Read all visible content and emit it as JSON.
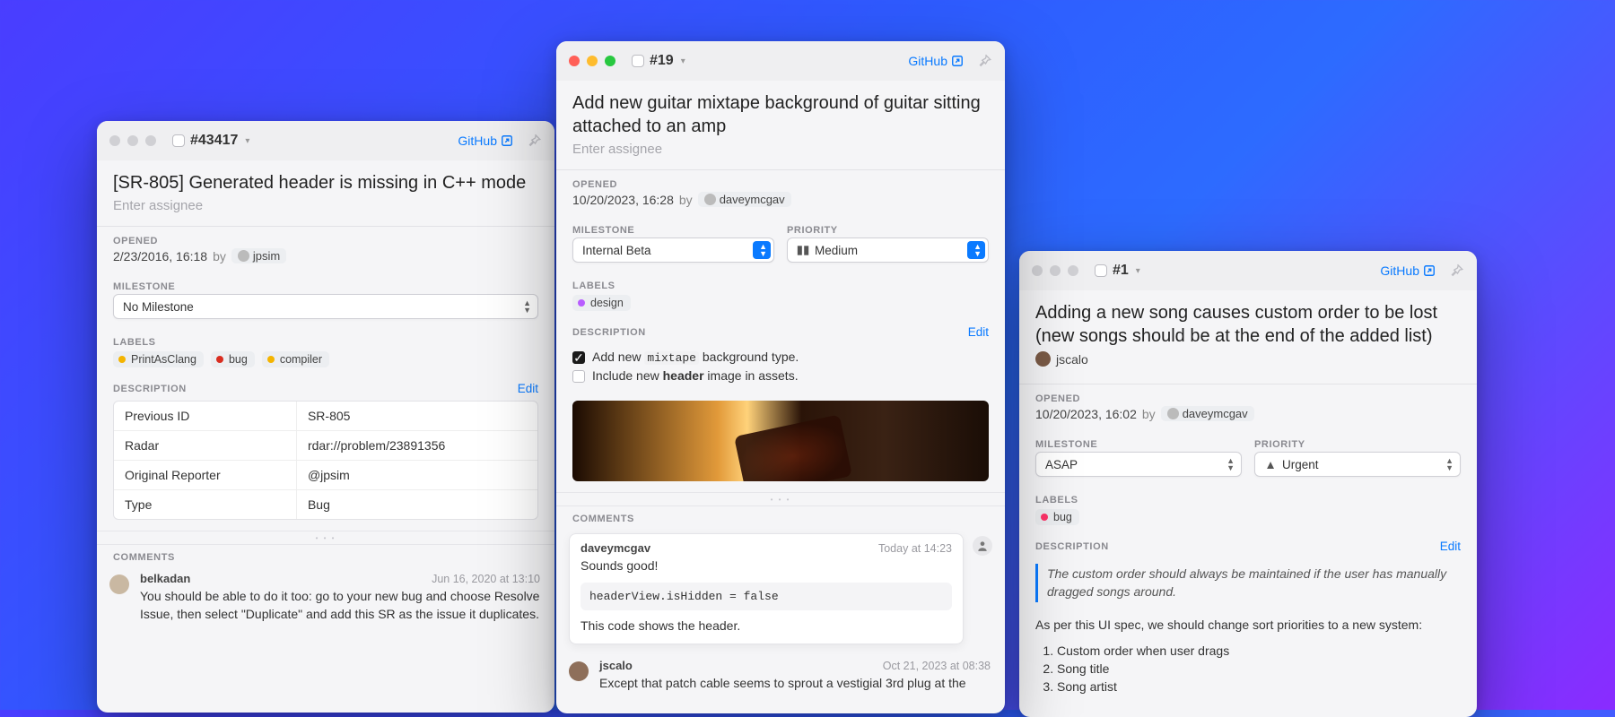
{
  "left": {
    "issue_id": "#43417",
    "github": "GitHub",
    "title": "[SR-805] Generated header is missing in C++ mode",
    "assignee_placeholder": "Enter assignee",
    "opened_label": "Opened",
    "opened": "2/23/2016, 16:18",
    "by": "by",
    "author": "jpsim",
    "milestone_label": "Milestone",
    "milestone": "No Milestone",
    "labels_label": "Labels",
    "labels": [
      {
        "color": "#f4b400",
        "name": "PrintAsClang"
      },
      {
        "color": "#d92d20",
        "name": "bug"
      },
      {
        "color": "#f4b400",
        "name": "compiler"
      }
    ],
    "description_label": "Description",
    "edit": "Edit",
    "table": [
      {
        "k": "Previous ID",
        "v": "SR-805"
      },
      {
        "k": "Radar",
        "v": "rdar://problem/23891356"
      },
      {
        "k": "Original Reporter",
        "v": "@jpsim"
      },
      {
        "k": "Type",
        "v": "Bug"
      }
    ],
    "comments_label": "Comments",
    "comment": {
      "author": "belkadan",
      "time": "Jun 16, 2020 at 13:10",
      "text": "You should be able to do it too: go to your new bug and choose Resolve Issue, then select \"Duplicate\" and add this SR as the issue it duplicates."
    }
  },
  "mid": {
    "issue_id": "#19",
    "github": "GitHub",
    "title": "Add new guitar mixtape background of guitar sitting attached to an amp",
    "assignee_placeholder": "Enter assignee",
    "opened_label": "Opened",
    "opened": "10/20/2023, 16:28",
    "by": "by",
    "author": "daveymcgav",
    "milestone_label": "Milestone",
    "milestone": "Internal Beta",
    "priority_label": "Priority",
    "priority": "Medium",
    "labels_label": "Labels",
    "labels": [
      {
        "color": "#b85cff",
        "name": "design"
      }
    ],
    "description_label": "Description",
    "edit": "Edit",
    "check1_pre": "Add new ",
    "check1_code": "mixtape",
    "check1_post": " background type.",
    "check2_pre": "Include new ",
    "check2_bold": "header",
    "check2_post": " image in assets.",
    "comments_label": "Comments",
    "c1": {
      "author": "daveymcgav",
      "time": "Today at 14:23",
      "line1": "Sounds good!",
      "code": "headerView.isHidden = false",
      "line2": "This code shows the header."
    },
    "c2": {
      "author": "jscalo",
      "time": "Oct 21, 2023 at 08:38",
      "text": "Except that patch cable seems to sprout a vestigial 3rd plug at the"
    }
  },
  "right": {
    "issue_id": "#1",
    "github": "GitHub",
    "title": "Adding a new song causes custom order to be lost (new songs should be at the end of the added list)",
    "assignee": "jscalo",
    "opened_label": "Opened",
    "opened": "10/20/2023, 16:02",
    "by": "by",
    "author": "daveymcgav",
    "milestone_label": "Milestone",
    "milestone": "ASAP",
    "priority_label": "Priority",
    "priority": "Urgent",
    "labels_label": "Labels",
    "labels": [
      {
        "color": "#ff3369",
        "name": "bug"
      }
    ],
    "description_label": "Description",
    "edit": "Edit",
    "quote": "The custom order should always be maintained if the user has manually dragged songs around.",
    "body": "As per this UI spec, we should change sort priorities to a new system:",
    "ol1": "Custom order when user drags",
    "ol2": "Song title",
    "ol3": "Song artist"
  }
}
